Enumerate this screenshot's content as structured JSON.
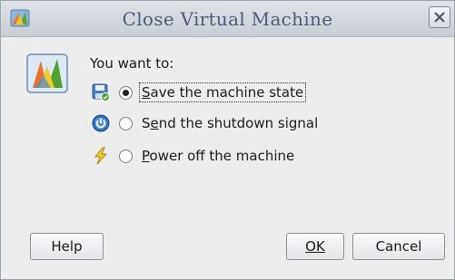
{
  "window": {
    "title": "Close Virtual Machine"
  },
  "dialog": {
    "prompt": "You want to:",
    "options": [
      {
        "pre": "",
        "ul": "S",
        "post": "ave the machine state",
        "checked": true,
        "icon": "save-state-icon"
      },
      {
        "pre": "S",
        "ul": "e",
        "post": "nd the shutdown signal",
        "checked": false,
        "icon": "power-button-icon"
      },
      {
        "pre": "",
        "ul": "P",
        "post": "ower off the machine",
        "checked": false,
        "icon": "lightning-icon"
      }
    ]
  },
  "buttons": {
    "help": "Help",
    "ok": "OK",
    "cancel": "Cancel"
  },
  "icons": {
    "title": "virtualbox-icon",
    "close": "close-icon",
    "dialog": "virtualbox-icon"
  },
  "colors": {
    "title_text": "#4a5d7a",
    "window_bg": "#ededed"
  }
}
